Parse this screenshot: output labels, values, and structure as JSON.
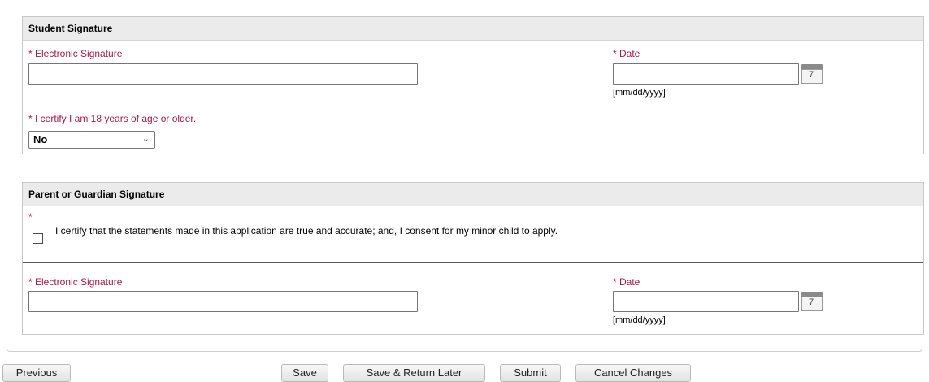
{
  "student": {
    "section_title": "Student Signature",
    "signature_label": "* Electronic Signature",
    "signature_value": "",
    "date_label": "* Date",
    "date_value": "",
    "date_format": "[mm/dd/yyyy]",
    "calendar_day": "7",
    "age_label": "* I certify I am 18 years of age or older.",
    "age_selected": "No"
  },
  "parent": {
    "section_title": "Parent or Guardian Signature",
    "required_marker": "*",
    "consent_text": "I certify that the statements made in this application are true and accurate; and, I consent for my minor child to apply.",
    "consent_checked": false,
    "signature_label": "* Electronic Signature",
    "signature_value": "",
    "date_label": "* Date",
    "date_value": "",
    "date_format": "[mm/dd/yyyy]",
    "calendar_day": "7"
  },
  "buttons": {
    "previous": "Previous",
    "save": "Save",
    "save_return": "Save & Return Later",
    "submit": "Submit",
    "cancel": "Cancel Changes"
  },
  "colors": {
    "required_label": "#a8174a",
    "section_header_bg": "#ebebeb"
  }
}
